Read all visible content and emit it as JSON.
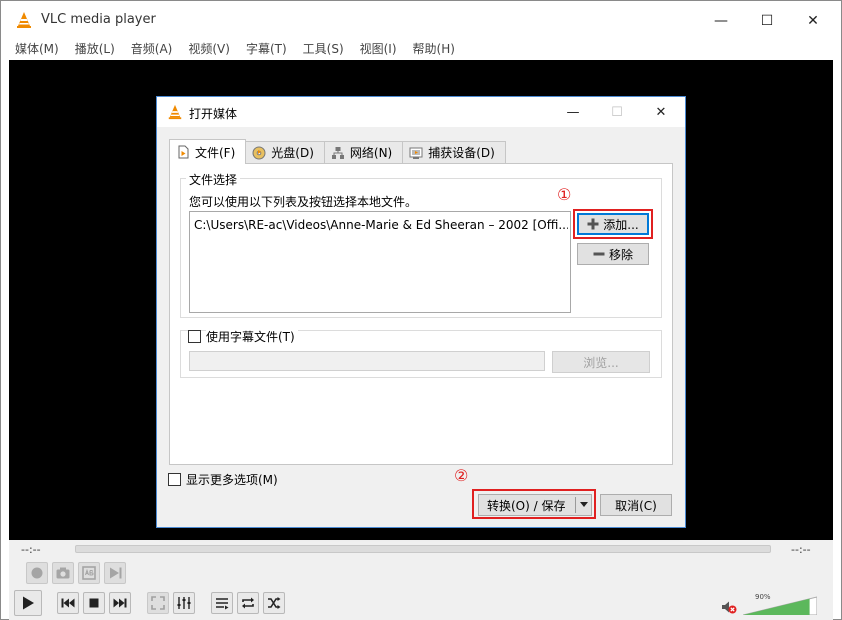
{
  "window": {
    "title": "VLC media player",
    "controls": {
      "minimize": "—",
      "maximize": "☐",
      "close": "✕"
    }
  },
  "menu": [
    "媒体(M)",
    "播放(L)",
    "音频(A)",
    "视频(V)",
    "字幕(T)",
    "工具(S)",
    "视图(I)",
    "帮助(H)"
  ],
  "player": {
    "time_elapsed": "--:--",
    "time_total": "--:--",
    "volume_label": "90%",
    "volume_level": 0.9
  },
  "dialog": {
    "title": "打开媒体",
    "controls": {
      "minimize": "—",
      "maximize": "☐",
      "close": "✕"
    },
    "tabs": [
      {
        "label": "文件(F)",
        "icon": "file-icon",
        "active": true
      },
      {
        "label": "光盘(D)",
        "icon": "disc-icon",
        "active": false
      },
      {
        "label": "网络(N)",
        "icon": "network-icon",
        "active": false
      },
      {
        "label": "捕获设备(D)",
        "icon": "capture-device-icon",
        "active": false
      }
    ],
    "file_group": {
      "legend": "文件选择",
      "hint": "您可以使用以下列表及按钮选择本地文件。",
      "files": [
        "C:\\Users\\RE-ac\\Videos\\Anne-Marie & Ed Sheeran – 2002 [Offi..."
      ],
      "add_label": "添加...",
      "remove_label": "移除"
    },
    "subtitle_group": {
      "checkbox_label": "使用字幕文件(T)",
      "checked": false,
      "path_value": "",
      "browse_label": "浏览..."
    },
    "more_options_label": "显示更多选项(M)",
    "convert_label": "转换(O) / 保存",
    "cancel_label": "取消(C)"
  },
  "annotations": {
    "marker_1": "①",
    "marker_2": "②",
    "color": "#e02020"
  }
}
